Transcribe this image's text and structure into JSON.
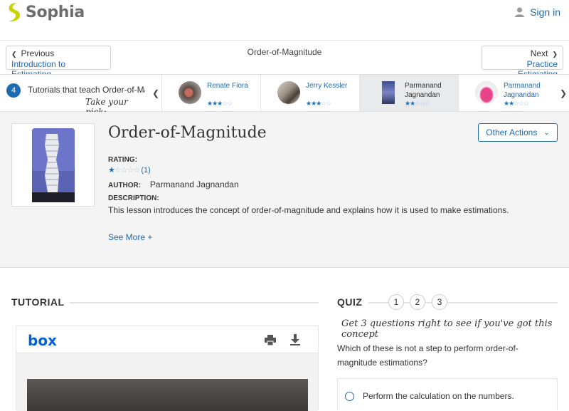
{
  "header": {
    "logo_text": "Sophia",
    "signin_label": "Sign in"
  },
  "nav": {
    "prev_small": "Previous",
    "prev_link": "Introduction to Estimating",
    "page_title": "Order-of-Magnitude",
    "next_small": "Next",
    "next_link": "Practice Estimating"
  },
  "tutorials": {
    "count": "4",
    "count_label": "Tutorials that teach Order-of-Magnitude",
    "pick_label": "Take your pick:",
    "cards": [
      {
        "name": "Renate Fiora",
        "rating": 3
      },
      {
        "name": "Jerry Kessler",
        "rating": 3
      },
      {
        "name": "Parmanand Jagnandan",
        "rating": 2
      },
      {
        "name": "Parmanand Jagnandan",
        "rating": 2
      }
    ]
  },
  "lesson": {
    "title": "Order-of-Magnitude",
    "other_actions": "Other Actions",
    "rating_label": "RATING:",
    "rating_count": "(1)",
    "rating_value": 1,
    "author_label": "AUTHOR:",
    "author": "Parmanand Jagnandan",
    "description_label": "DESCRIPTION:",
    "description": "This lesson introduces the concept of order-of-magnitude and explains how it is used to make estimations.",
    "see_more": "See More +"
  },
  "tutorial_section": {
    "heading": "TUTORIAL",
    "viewer_logo": "box"
  },
  "quiz": {
    "heading": "QUIZ",
    "steps": [
      "1",
      "2",
      "3"
    ],
    "hint": "Get 3 questions right to see if you've got this concept",
    "question": "Which of these is not a step to perform order-of-magnitude estimations?",
    "answers": [
      "Perform the calculation on the numbers."
    ]
  },
  "colors": {
    "accent": "#1f6bb0",
    "logo_green": "#c8d400",
    "box_blue": "#0061d5"
  }
}
